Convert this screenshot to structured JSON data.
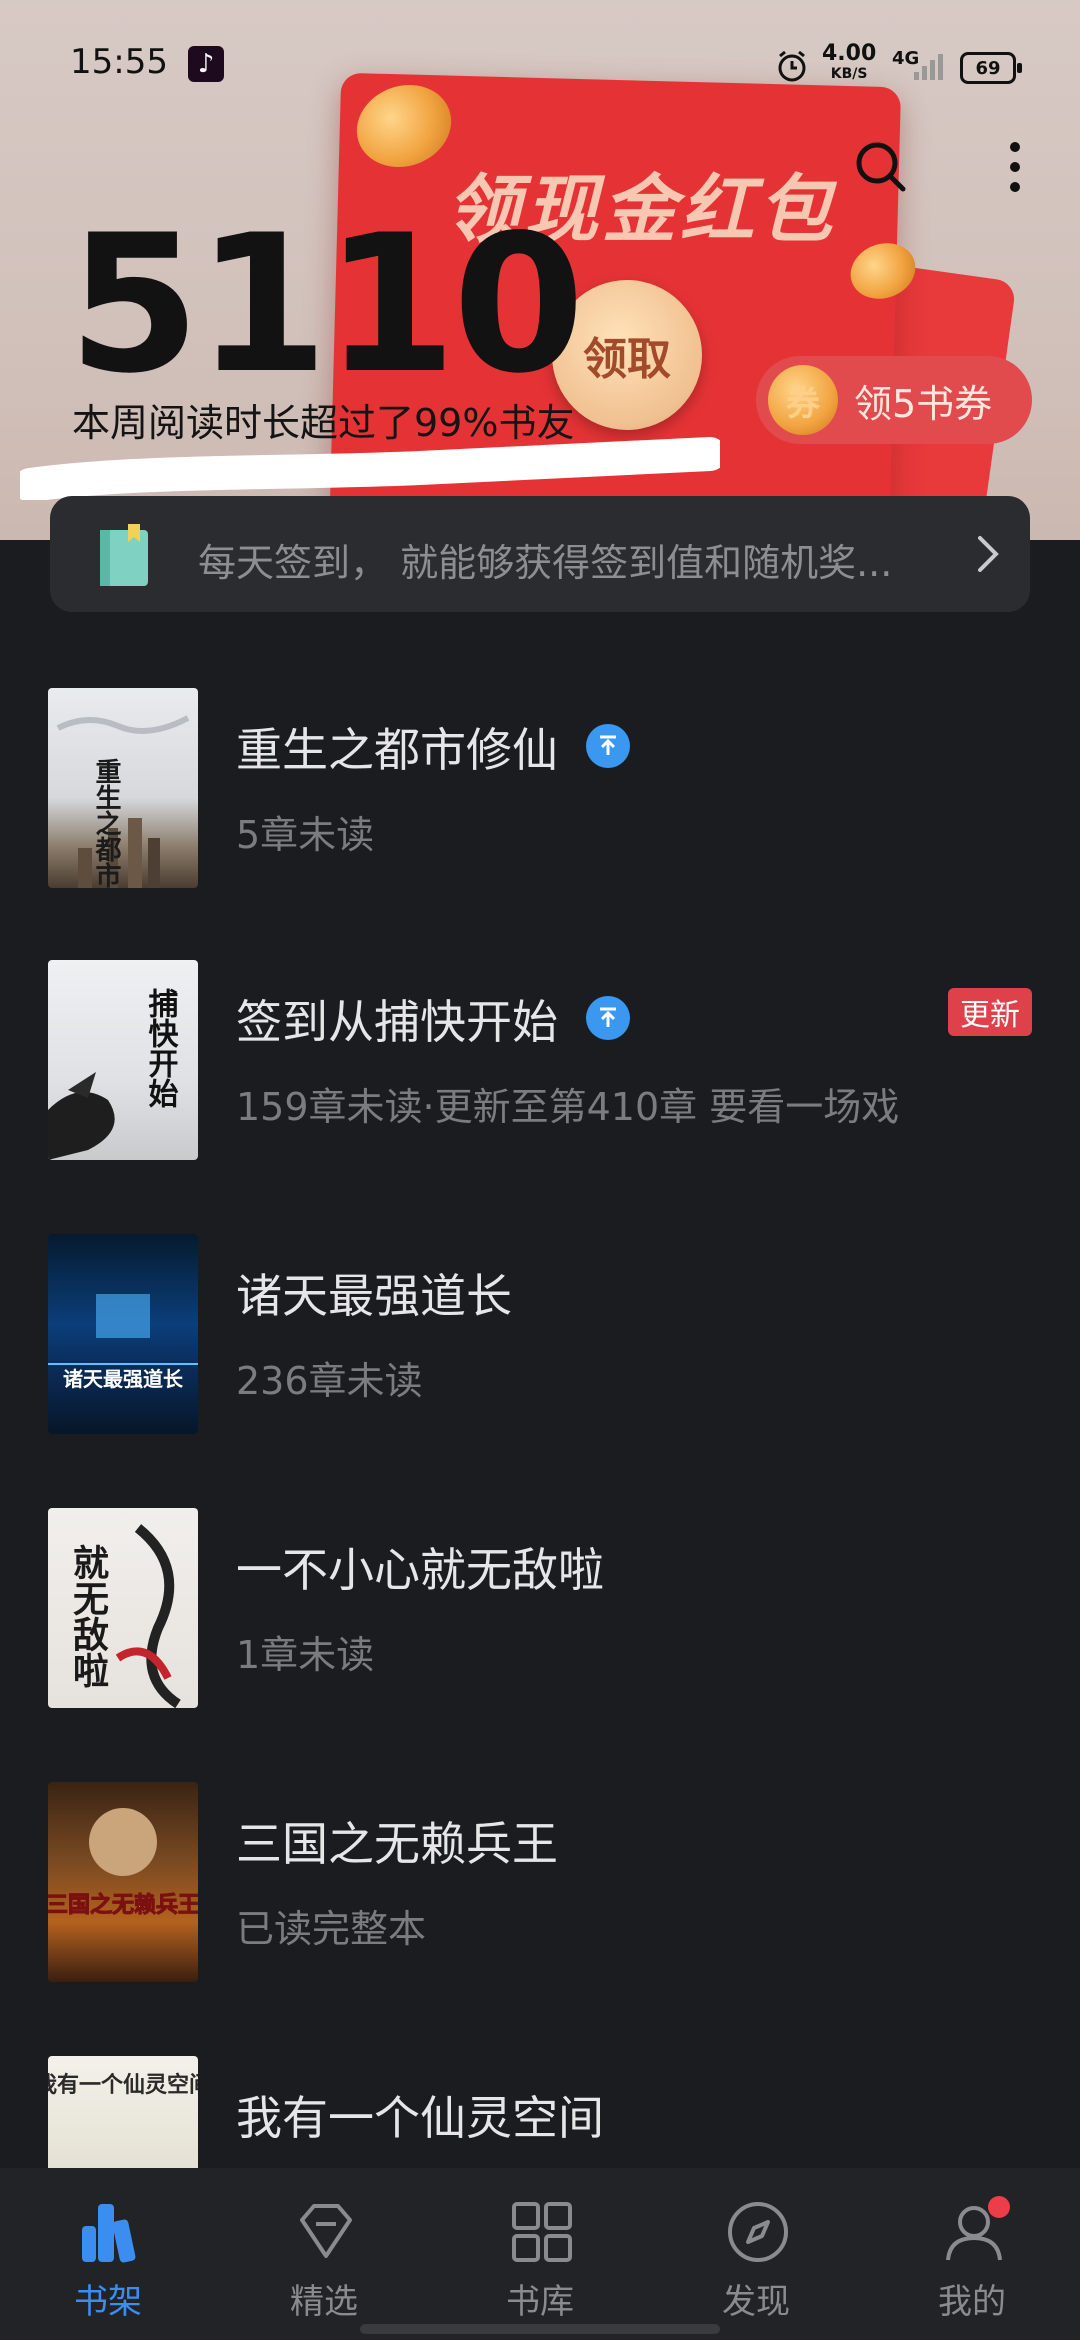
{
  "status_bar": {
    "time": "15:55",
    "speed_value": "4.00",
    "speed_unit": "KB/S",
    "network": "4G",
    "battery": "69"
  },
  "hero": {
    "envelope_title": "领现金红包",
    "claim_button": "领取",
    "voucher_label": "领5书券",
    "voucher_coin": "券",
    "reading_minutes": "5110",
    "reading_stat": "本周阅读时长超过了99%书友"
  },
  "signin": {
    "text": "每天签到， 就能够获得签到值和随机奖..."
  },
  "books": [
    {
      "title": "重生之都市修仙",
      "status": "5章未读",
      "pinned": true,
      "update": ""
    },
    {
      "title": "签到从捕快开始",
      "status": "159章未读·更新至第410章 要看一场戏",
      "pinned": true,
      "update": "更新"
    },
    {
      "title": "诸天最强道长",
      "status": "236章未读",
      "pinned": false,
      "update": ""
    },
    {
      "title": "一不小心就无敌啦",
      "status": "1章未读",
      "pinned": false,
      "update": ""
    },
    {
      "title": "三国之无赖兵王",
      "status": "已读完整本",
      "pinned": false,
      "update": ""
    },
    {
      "title": "我有一个仙灵空间",
      "status": "",
      "pinned": false,
      "update": ""
    }
  ],
  "covers": {
    "book1": "重生之都市修仙",
    "book2": "捕快开始",
    "book3": "诸天最强道长",
    "book4": "就无敌啦",
    "book5": "三国之无赖兵王",
    "book6": "我有一个仙灵空间"
  },
  "nav": {
    "shelf": "书架",
    "featured": "精选",
    "library": "书库",
    "discover": "发现",
    "mine": "我的"
  },
  "colors": {
    "accent": "#3b8df0",
    "background": "#1b1c1f",
    "envelope_red": "#e53335",
    "update_red": "#de4149"
  }
}
